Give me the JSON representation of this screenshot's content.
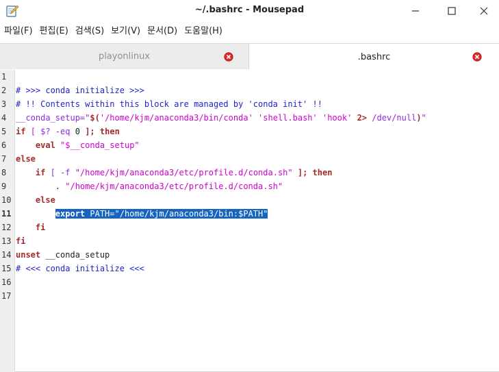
{
  "window": {
    "title": "~/.bashrc - Mousepad",
    "app_icon": "mousepad-icon",
    "controls": [
      "minimize-icon",
      "maximize-icon",
      "close-icon"
    ]
  },
  "menu": [
    "파일(F)",
    "편집(E)",
    "검색(S)",
    "보기(V)",
    "문서(D)",
    "도움말(H)"
  ],
  "tabs": [
    {
      "label": "playonlinux",
      "active": false
    },
    {
      "label": ".bashrc",
      "active": true
    }
  ],
  "editor": {
    "current_line": 11,
    "line_numbers": [
      "1",
      "2",
      "3",
      "4",
      "5",
      "6",
      "7",
      "8",
      "9",
      "10",
      "11",
      "12",
      "13",
      "14",
      "15",
      "16",
      "17"
    ],
    "lines": [
      [],
      [
        {
          "t": "# >>> conda initialize >>>",
          "c": "comment"
        }
      ],
      [
        {
          "t": "# !! Contents within this block are managed by 'conda init' !!",
          "c": "comment"
        }
      ],
      [
        {
          "t": "__conda_setup=",
          "c": "var"
        },
        {
          "t": "\"",
          "c": "str"
        },
        {
          "t": "$(",
          "c": "op"
        },
        {
          "t": "'/home/kjm/anaconda3/bin/conda'",
          "c": "str"
        },
        {
          "t": " ",
          "c": "pl"
        },
        {
          "t": "'shell.bash'",
          "c": "str"
        },
        {
          "t": " ",
          "c": "pl"
        },
        {
          "t": "'hook'",
          "c": "str"
        },
        {
          "t": " ",
          "c": "pl"
        },
        {
          "t": "2>",
          "c": "op"
        },
        {
          "t": " /",
          "c": "str"
        },
        {
          "t": "dev",
          "c": "var"
        },
        {
          "t": "/",
          "c": "str"
        },
        {
          "t": "null",
          "c": "var"
        },
        {
          "t": ")",
          "c": "op"
        },
        {
          "t": "\"",
          "c": "str"
        }
      ],
      [
        {
          "t": "if",
          "c": "kw"
        },
        {
          "t": " ",
          "c": "pl"
        },
        {
          "t": "[",
          "c": "var"
        },
        {
          "t": " ",
          "c": "pl"
        },
        {
          "t": "$?",
          "c": "var"
        },
        {
          "t": " -eq ",
          "c": "var"
        },
        {
          "t": "0",
          "c": "pl"
        },
        {
          "t": " ",
          "c": "pl"
        },
        {
          "t": "];",
          "c": "op"
        },
        {
          "t": " ",
          "c": "pl"
        },
        {
          "t": "then",
          "c": "kw"
        }
      ],
      [
        {
          "t": "    ",
          "c": "pl"
        },
        {
          "t": "eval",
          "c": "kw"
        },
        {
          "t": " ",
          "c": "pl"
        },
        {
          "t": "\"$__conda_setup\"",
          "c": "str"
        }
      ],
      [
        {
          "t": "else",
          "c": "kw"
        }
      ],
      [
        {
          "t": "    ",
          "c": "pl"
        },
        {
          "t": "if",
          "c": "kw"
        },
        {
          "t": " ",
          "c": "pl"
        },
        {
          "t": "[",
          "c": "var"
        },
        {
          "t": " -f ",
          "c": "var"
        },
        {
          "t": "\"/home/kjm/anaconda3/etc/profile.d/conda.sh\"",
          "c": "str"
        },
        {
          "t": " ",
          "c": "pl"
        },
        {
          "t": "];",
          "c": "op"
        },
        {
          "t": " ",
          "c": "pl"
        },
        {
          "t": "then",
          "c": "kw"
        }
      ],
      [
        {
          "t": "        . ",
          "c": "pl"
        },
        {
          "t": "\"/home/kjm/anaconda3/etc/profile.d/conda.sh\"",
          "c": "str"
        }
      ],
      [
        {
          "t": "    ",
          "c": "pl"
        },
        {
          "t": "else",
          "c": "kw"
        }
      ],
      [
        {
          "t": "        ",
          "c": "pl"
        },
        {
          "t": "export",
          "c": "sel-kw"
        },
        {
          "t": " PATH=\"/home/kjm/anaconda3/bin:$PATH\"",
          "c": "sel"
        }
      ],
      [
        {
          "t": "    ",
          "c": "pl"
        },
        {
          "t": "fi",
          "c": "kw"
        }
      ],
      [
        {
          "t": "fi",
          "c": "kw"
        }
      ],
      [
        {
          "t": "unset",
          "c": "kw"
        },
        {
          "t": " __conda_setup",
          "c": "pl"
        }
      ],
      [
        {
          "t": "# <<< conda initialize <<<",
          "c": "comment"
        }
      ],
      [],
      []
    ]
  }
}
